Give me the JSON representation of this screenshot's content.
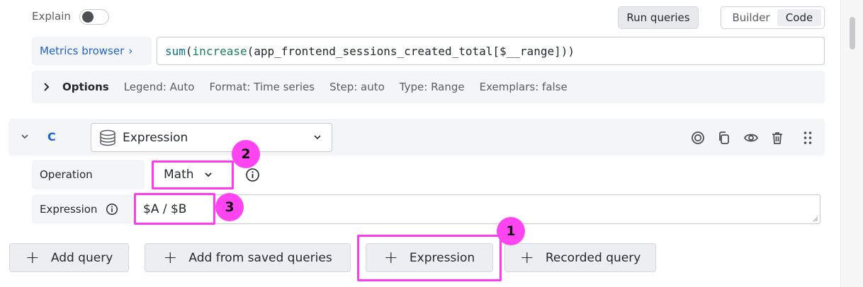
{
  "top": {
    "explain_label": "Explain",
    "explain_enabled": false,
    "run_queries_label": "Run queries",
    "mode_options": [
      "Builder",
      "Code"
    ],
    "mode_builder_label": "Builder",
    "mode_code_label": "Code",
    "mode_selected": "Code"
  },
  "metrics": {
    "browser_label": "Metrics browser",
    "browser_chevron": "›",
    "query_sum": "sum",
    "query_paren_open": "(",
    "query_increase": "increase",
    "query_rest": "(app_frontend_sessions_created_total[$__range]))"
  },
  "options": {
    "title": "Options",
    "legend": "Legend: Auto",
    "format": "Format: Time series",
    "step": "Step: auto",
    "type": "Type: Range",
    "exemplars": "Exemplars: false"
  },
  "query_c": {
    "ref_id": "C",
    "datasource": "Expression",
    "operation_label": "Operation",
    "operation_value": "Math",
    "expression_label": "Expression",
    "expression_value": "$A / $B",
    "header_icons": [
      "circle-target-icon",
      "duplicate-icon",
      "eye-icon",
      "trash-icon",
      "drag-handle-icon"
    ]
  },
  "buttons": {
    "add_query": "Add query",
    "add_saved": "Add from saved queries",
    "expression": "Expression",
    "recorded_query": "Recorded query"
  },
  "annotations": {
    "badge_1": "1",
    "badge_2": "2",
    "badge_3": "3",
    "highlight_color": "#ff3bf0"
  },
  "colors": {
    "link_blue": "#1f62c9",
    "panel_bg": "#f4f5f6"
  }
}
